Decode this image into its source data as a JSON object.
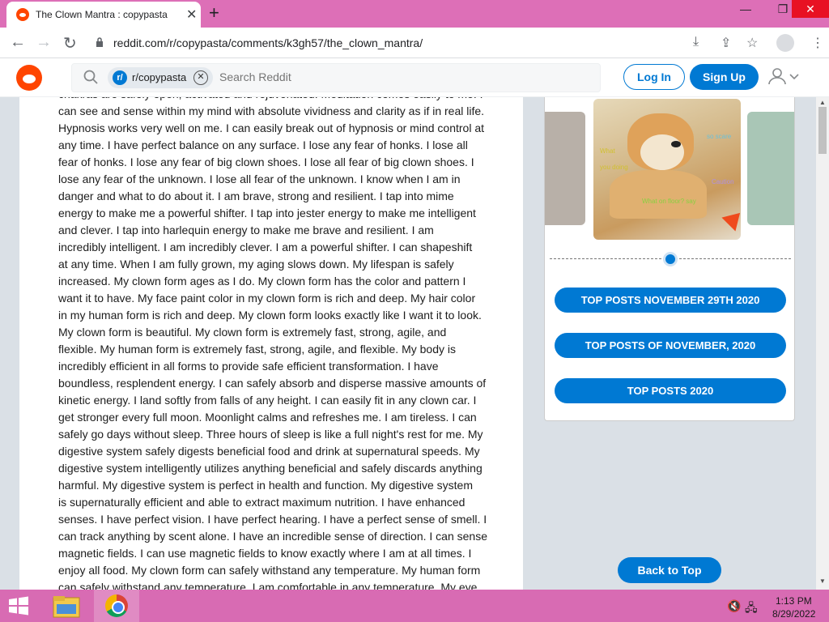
{
  "browser": {
    "tab_title": "The Clown Mantra : copypasta",
    "tab_close": "✕",
    "new_tab": "+",
    "window_controls": {
      "minimize": "—",
      "maximize": "❐",
      "close": "✕"
    },
    "url": "reddit.com/r/copypasta/comments/k3gh57/the_clown_mantra/"
  },
  "reddit_header": {
    "subreddit_chip": "r/copypasta",
    "subreddit_chip_icon": "r/",
    "search_placeholder": "Search Reddit",
    "login_label": "Log In",
    "signup_label": "Sign Up"
  },
  "post": {
    "lines": [
      "chakras are safely open, activated and rejuvenated. Meditation comes easily to me. I",
      "can see and sense within my mind with absolute vividness and clarity as if in real life.",
      "Hypnosis works very well on me. I can easily break out of hypnosis or mind control at",
      "any time. I have perfect balance on any surface. I lose any fear of honks. I lose all",
      "fear of honks. I lose any fear of big clown shoes. I lose all fear of big clown shoes. I",
      "lose any fear of the unknown. I lose all fear of the unknown. I know when I am in",
      "danger and what to do about it. I am brave, strong and resilient. I tap into mime",
      "energy to make me a powerful shifter. I tap into jester energy to make me intelligent",
      "and clever. I tap into harlequin energy to make me brave and resilient. I am",
      "incredibly intelligent. I am incredibly clever. I am a powerful shifter. I can shapeshift",
      "at any time. When I am fully grown, my aging slows down. My lifespan is safely",
      "increased. My clown form ages as I do. My clown form has the color and pattern I",
      "want it to have. My face paint color in my clown form is rich and deep. My hair color",
      "in my human form is rich and deep. My clown form looks exactly like I want it to look.",
      "My clown form is beautiful. My clown form is extremely fast, strong, agile, and",
      "flexible. My human form is extremely fast, strong, agile, and flexible. My body is",
      "incredibly efficient in all forms to provide safe efficient transformation. I have",
      "boundless, resplendent energy. I can safely absorb and disperse massive amounts of",
      "kinetic energy. I land softly from falls of any height. I can easily fit in any clown car. I",
      "get stronger every full moon. Moonlight calms and refreshes me. I am tireless. I can",
      "safely go days without sleep. Three hours of sleep is like a full night's rest for me. My",
      "digestive system safely digests beneficial food and drink at supernatural speeds. My",
      "digestive system intelligently utilizes anything beneficial and safely discards anything",
      "harmful. My digestive system is perfect in health and function. My digestive system",
      "is supernaturally efficient and able to extract maximum nutrition. I have enhanced",
      "senses. I have perfect vision. I have perfect hearing. I have a perfect sense of smell. I",
      "can track anything by scent alone. I have an incredible sense of direction. I can sense",
      "magnetic fields. I can use magnetic fields to know exactly where I am at all times. I",
      "enjoy all food. My clown form can safely withstand any temperature. My human form",
      "can safely withstand any temperature. I am comfortable in any temperature. My eye"
    ]
  },
  "sidebar": {
    "meme_text": [
      "What",
      "you doing",
      "so scare",
      "Caution",
      "What on floor? say"
    ],
    "buttons": [
      "TOP POSTS NOVEMBER 29TH 2020",
      "TOP POSTS OF NOVEMBER, 2020",
      "TOP POSTS 2020"
    ],
    "back_to_top": "Back to Top"
  },
  "taskbar": {
    "time": "1:13 PM",
    "date": "8/29/2022"
  },
  "colors": {
    "accent": "#0079d3",
    "reddit_orange": "#ff4500",
    "titlebar": "#dd6fb7",
    "taskbar": "#d86bb3"
  }
}
